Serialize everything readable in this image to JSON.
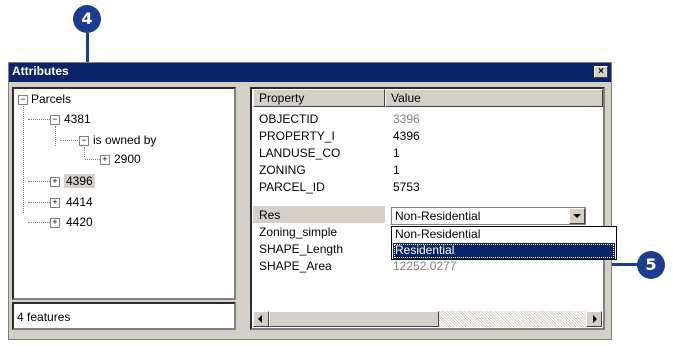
{
  "window": {
    "title": "Attributes",
    "close_glyph": "×"
  },
  "tree": {
    "root": "Parcels",
    "node_4381": "4381",
    "relation": "is owned by",
    "node_2900": "2900",
    "node_4396": "4396",
    "node_4414": "4414",
    "node_4420": "4420"
  },
  "status": {
    "text": "4 features"
  },
  "grid": {
    "col_property": "Property",
    "col_value": "Value",
    "rows": [
      {
        "property": "OBJECTID",
        "value": "3396"
      },
      {
        "property": "PROPERTY_I",
        "value": "4396"
      },
      {
        "property": "LANDUSE_CO",
        "value": "1"
      },
      {
        "property": "ZONING",
        "value": "1"
      },
      {
        "property": "PARCEL_ID",
        "value": "5753"
      },
      {
        "property": "Res",
        "value": "Non-Residential"
      },
      {
        "property": "Zoning_simple",
        "value": ""
      },
      {
        "property": "SHAPE_Length",
        "value": ""
      },
      {
        "property": "SHAPE_Area",
        "value": "12252.0277"
      }
    ]
  },
  "dropdown": {
    "options": [
      "Non-Residential",
      "Residential"
    ],
    "highlighted": "Residential"
  },
  "callouts": {
    "top": "4",
    "right": "5"
  },
  "colors": {
    "titlebar": "#0a246a",
    "highlight": "#0a246a",
    "callout": "#1a3d8f"
  }
}
